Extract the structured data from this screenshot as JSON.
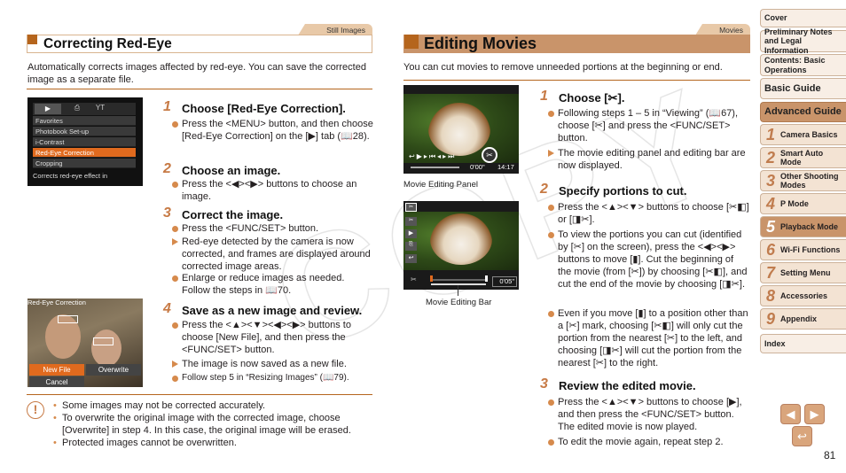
{
  "left_section": {
    "tab": "Still Images",
    "title": "Correcting Red-Eye",
    "intro": "Automatically corrects images affected by red-eye. You can save the corrected image as a separate file.",
    "menu_screen": {
      "tabs": [
        "▶",
        "⎙",
        "YT"
      ],
      "items": [
        "Favorites",
        "Photobook Set-up",
        "i-Contrast",
        "Red-Eye Correction",
        "Cropping"
      ],
      "selected": "Red-Eye Correction",
      "footer": "Corrects red-eye effect in"
    },
    "redeye_screen": {
      "title": "Red-Eye Correction",
      "buttons": [
        "New File",
        "Overwrite",
        "Cancel"
      ]
    },
    "steps": [
      {
        "num": "1",
        "title": "Choose [Red-Eye Correction].",
        "bullets": [
          {
            "type": "dot",
            "text": "Press the <MENU> button, and then choose [Red-Eye Correction] on the [▶] tab (📖28)."
          }
        ]
      },
      {
        "num": "2",
        "title": "Choose an image.",
        "bullets": [
          {
            "type": "dot",
            "text": "Press the <◀><▶> buttons to choose an image."
          }
        ]
      },
      {
        "num": "3",
        "title": "Correct the image.",
        "bullets": [
          {
            "type": "dot",
            "text": "Press the <FUNC/SET> button."
          },
          {
            "type": "arrow",
            "text": "Red-eye detected by the camera is now corrected, and frames are displayed around corrected image areas."
          },
          {
            "type": "dot",
            "text": "Enlarge or reduce images as needed. Follow the steps in 📖70."
          }
        ]
      },
      {
        "num": "4",
        "title": "Save as a new image and review.",
        "bullets": [
          {
            "type": "dot",
            "text": "Press the <▲><▼><◀><▶> buttons to choose [New File], and then press the <FUNC/SET> button."
          },
          {
            "type": "arrow",
            "text": "The image is now saved as a new file."
          },
          {
            "type": "dot",
            "text": "Follow step 5 in “Resizing Images” (📖79)."
          }
        ]
      }
    ],
    "notes": [
      "Some images may not be corrected accurately.",
      "To overwrite the original image with the corrected image, choose [Overwrite] in step 4. In this case, the original image will be erased.",
      "Protected images cannot be overwritten."
    ]
  },
  "right_section": {
    "tab": "Movies",
    "title": "Editing Movies",
    "intro": "You can cut movies to remove unneeded portions at the beginning or end.",
    "screen1": {
      "time": "0'00\"",
      "total": "14:17"
    },
    "screen2": {
      "time": "0'05\""
    },
    "caption_panel": "Movie Editing Panel",
    "caption_bar": "Movie Editing Bar",
    "steps": [
      {
        "num": "1",
        "title": "Choose [✂].",
        "bullets": [
          {
            "type": "dot",
            "text": "Following steps 1 – 5 in “Viewing” (📖67), choose [✂] and press the <FUNC/SET> button."
          },
          {
            "type": "arrow",
            "text": "The movie editing panel and editing bar are now displayed."
          }
        ]
      },
      {
        "num": "2",
        "title": "Specify portions to cut.",
        "bullets": [
          {
            "type": "dot",
            "text": "Press the <▲><▼> buttons to choose [✂◧] or [◨✂]."
          },
          {
            "type": "dot",
            "text": "To view the portions you can cut (identified by [✂] on the screen), press the <◀><▶> buttons to move [▮]. Cut the beginning of the movie (from [✂]) by choosing [✂◧], and cut the end of the movie by choosing [◨✂]."
          },
          {
            "type": "dot",
            "text": "Even if you move [▮] to a position other than a [✂] mark, choosing [✂◧] will only cut the portion from the nearest [✂] to the left, and choosing [◨✂] will cut the portion from the nearest [✂] to the right."
          }
        ]
      },
      {
        "num": "3",
        "title": "Review the edited movie.",
        "bullets": [
          {
            "type": "dot",
            "text": "Press the <▲><▼> buttons to choose [▶], and then press the <FUNC/SET> button. The edited movie is now played."
          },
          {
            "type": "dot",
            "text": "To edit the movie again, repeat step 2."
          }
        ]
      }
    ]
  },
  "sidebar": {
    "top": [
      "Cover",
      "Preliminary Notes and Legal Information",
      "Contents: Basic Operations",
      "Basic Guide",
      "Advanced Guide"
    ],
    "chapters": [
      {
        "num": "1",
        "label": "Camera Basics"
      },
      {
        "num": "2",
        "label": "Smart Auto Mode"
      },
      {
        "num": "3",
        "label": "Other Shooting Modes"
      },
      {
        "num": "4",
        "label": "P Mode"
      },
      {
        "num": "5",
        "label": "Playback Mode"
      },
      {
        "num": "6",
        "label": "Wi-Fi Functions"
      },
      {
        "num": "7",
        "label": "Setting Menu"
      },
      {
        "num": "8",
        "label": "Accessories"
      },
      {
        "num": "9",
        "label": "Appendix"
      }
    ],
    "index": "Index",
    "active_chapter": "5"
  },
  "nav": {
    "prev": "◀",
    "next": "▶",
    "back": "↩",
    "page": "81"
  },
  "watermark": "COPY"
}
